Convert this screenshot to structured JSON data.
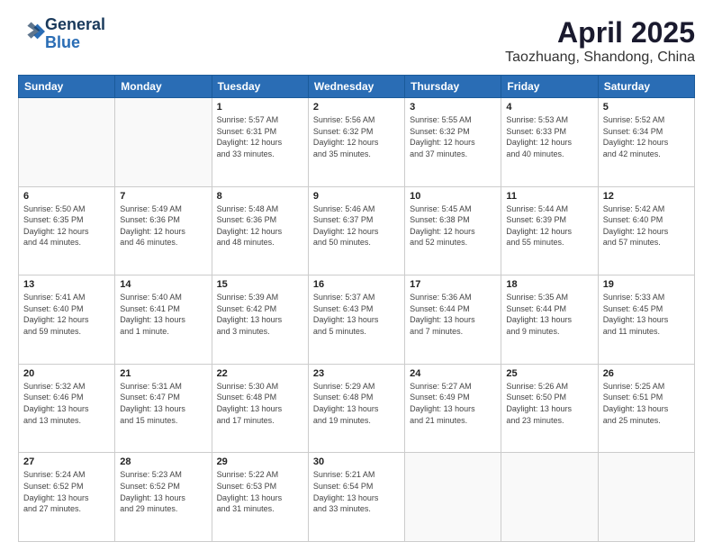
{
  "header": {
    "logo_line1": "General",
    "logo_line2": "Blue",
    "title": "April 2025",
    "subtitle": "Taozhuang, Shandong, China"
  },
  "days_of_week": [
    "Sunday",
    "Monday",
    "Tuesday",
    "Wednesday",
    "Thursday",
    "Friday",
    "Saturday"
  ],
  "weeks": [
    [
      {
        "day": "",
        "info": ""
      },
      {
        "day": "",
        "info": ""
      },
      {
        "day": "1",
        "info": "Sunrise: 5:57 AM\nSunset: 6:31 PM\nDaylight: 12 hours\nand 33 minutes."
      },
      {
        "day": "2",
        "info": "Sunrise: 5:56 AM\nSunset: 6:32 PM\nDaylight: 12 hours\nand 35 minutes."
      },
      {
        "day": "3",
        "info": "Sunrise: 5:55 AM\nSunset: 6:32 PM\nDaylight: 12 hours\nand 37 minutes."
      },
      {
        "day": "4",
        "info": "Sunrise: 5:53 AM\nSunset: 6:33 PM\nDaylight: 12 hours\nand 40 minutes."
      },
      {
        "day": "5",
        "info": "Sunrise: 5:52 AM\nSunset: 6:34 PM\nDaylight: 12 hours\nand 42 minutes."
      }
    ],
    [
      {
        "day": "6",
        "info": "Sunrise: 5:50 AM\nSunset: 6:35 PM\nDaylight: 12 hours\nand 44 minutes."
      },
      {
        "day": "7",
        "info": "Sunrise: 5:49 AM\nSunset: 6:36 PM\nDaylight: 12 hours\nand 46 minutes."
      },
      {
        "day": "8",
        "info": "Sunrise: 5:48 AM\nSunset: 6:36 PM\nDaylight: 12 hours\nand 48 minutes."
      },
      {
        "day": "9",
        "info": "Sunrise: 5:46 AM\nSunset: 6:37 PM\nDaylight: 12 hours\nand 50 minutes."
      },
      {
        "day": "10",
        "info": "Sunrise: 5:45 AM\nSunset: 6:38 PM\nDaylight: 12 hours\nand 52 minutes."
      },
      {
        "day": "11",
        "info": "Sunrise: 5:44 AM\nSunset: 6:39 PM\nDaylight: 12 hours\nand 55 minutes."
      },
      {
        "day": "12",
        "info": "Sunrise: 5:42 AM\nSunset: 6:40 PM\nDaylight: 12 hours\nand 57 minutes."
      }
    ],
    [
      {
        "day": "13",
        "info": "Sunrise: 5:41 AM\nSunset: 6:40 PM\nDaylight: 12 hours\nand 59 minutes."
      },
      {
        "day": "14",
        "info": "Sunrise: 5:40 AM\nSunset: 6:41 PM\nDaylight: 13 hours\nand 1 minute."
      },
      {
        "day": "15",
        "info": "Sunrise: 5:39 AM\nSunset: 6:42 PM\nDaylight: 13 hours\nand 3 minutes."
      },
      {
        "day": "16",
        "info": "Sunrise: 5:37 AM\nSunset: 6:43 PM\nDaylight: 13 hours\nand 5 minutes."
      },
      {
        "day": "17",
        "info": "Sunrise: 5:36 AM\nSunset: 6:44 PM\nDaylight: 13 hours\nand 7 minutes."
      },
      {
        "day": "18",
        "info": "Sunrise: 5:35 AM\nSunset: 6:44 PM\nDaylight: 13 hours\nand 9 minutes."
      },
      {
        "day": "19",
        "info": "Sunrise: 5:33 AM\nSunset: 6:45 PM\nDaylight: 13 hours\nand 11 minutes."
      }
    ],
    [
      {
        "day": "20",
        "info": "Sunrise: 5:32 AM\nSunset: 6:46 PM\nDaylight: 13 hours\nand 13 minutes."
      },
      {
        "day": "21",
        "info": "Sunrise: 5:31 AM\nSunset: 6:47 PM\nDaylight: 13 hours\nand 15 minutes."
      },
      {
        "day": "22",
        "info": "Sunrise: 5:30 AM\nSunset: 6:48 PM\nDaylight: 13 hours\nand 17 minutes."
      },
      {
        "day": "23",
        "info": "Sunrise: 5:29 AM\nSunset: 6:48 PM\nDaylight: 13 hours\nand 19 minutes."
      },
      {
        "day": "24",
        "info": "Sunrise: 5:27 AM\nSunset: 6:49 PM\nDaylight: 13 hours\nand 21 minutes."
      },
      {
        "day": "25",
        "info": "Sunrise: 5:26 AM\nSunset: 6:50 PM\nDaylight: 13 hours\nand 23 minutes."
      },
      {
        "day": "26",
        "info": "Sunrise: 5:25 AM\nSunset: 6:51 PM\nDaylight: 13 hours\nand 25 minutes."
      }
    ],
    [
      {
        "day": "27",
        "info": "Sunrise: 5:24 AM\nSunset: 6:52 PM\nDaylight: 13 hours\nand 27 minutes."
      },
      {
        "day": "28",
        "info": "Sunrise: 5:23 AM\nSunset: 6:52 PM\nDaylight: 13 hours\nand 29 minutes."
      },
      {
        "day": "29",
        "info": "Sunrise: 5:22 AM\nSunset: 6:53 PM\nDaylight: 13 hours\nand 31 minutes."
      },
      {
        "day": "30",
        "info": "Sunrise: 5:21 AM\nSunset: 6:54 PM\nDaylight: 13 hours\nand 33 minutes."
      },
      {
        "day": "",
        "info": ""
      },
      {
        "day": "",
        "info": ""
      },
      {
        "day": "",
        "info": ""
      }
    ]
  ]
}
